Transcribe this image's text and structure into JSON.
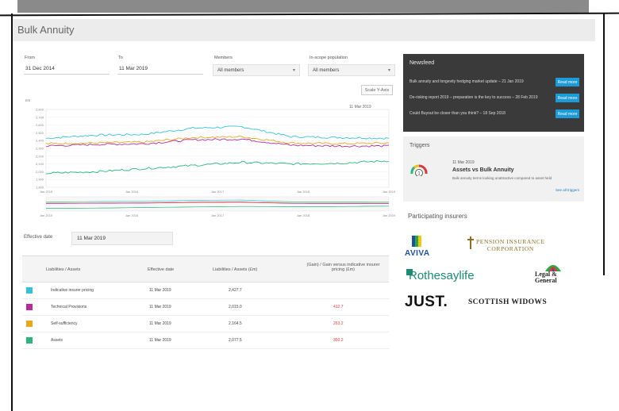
{
  "page": {
    "title": "Bulk Annuity"
  },
  "filters": {
    "from_label": "From",
    "from_value": "31 Dec 2014",
    "to_label": "To",
    "to_value": "11 Mar 2019",
    "members_label": "Members",
    "members_value": "All members",
    "in_scope_label": "In-scope population",
    "in_scope_value": "All members"
  },
  "scale_button": "Scale Y-Axis",
  "chart_data": {
    "type": "line",
    "date_label": "11 Mar 2019",
    "ylabel": "£m",
    "x": [
      "Jan 2015",
      "Jan 2016",
      "Jan 2017",
      "Jan 2018",
      "Jan 2019"
    ],
    "y_ticks": [
      "2,800",
      "2,700",
      "2,600",
      "2,500",
      "2,400",
      "2,300",
      "2,200",
      "2,100",
      "2,000",
      "1,900",
      "1,800"
    ],
    "ylim": [
      1800,
      2800
    ],
    "series": [
      {
        "color": "#35c2d9",
        "values": [
          2430,
          2470,
          2480,
          2560,
          2580,
          2450,
          2440,
          2430
        ]
      },
      {
        "color": "#e8a820",
        "values": [
          2360,
          2370,
          2380,
          2440,
          2450,
          2370,
          2360,
          2370
        ]
      },
      {
        "color": "#b8299a",
        "values": [
          2330,
          2350,
          2360,
          2410,
          2420,
          2340,
          2330,
          2330
        ]
      },
      {
        "color": "#2ab67c",
        "values": [
          1980,
          2000,
          2040,
          2080,
          2120,
          2100,
          2110,
          2140
        ]
      }
    ],
    "navigator_x": [
      "Jan 2015",
      "Jan 2016",
      "Jan 2017",
      "Jan 2018",
      "Jan 2019"
    ],
    "grid": true
  },
  "effective": {
    "label": "Effective date",
    "value": "11 Mar 2019"
  },
  "table": {
    "headers": [
      "Liabilities / Assets",
      "Effective date",
      "Liabilities / Assets (£m)",
      "(Gain) / Gain versus indicative insurer pricing (£m)"
    ],
    "rows": [
      {
        "color": "#35c2d9",
        "name": "Indicative insurer pricing",
        "date": "11 Mar 2019",
        "value": "2,427.7",
        "gain": ""
      },
      {
        "color": "#b8299a",
        "name": "Technical Provisions",
        "date": "11 Mar 2019",
        "value": "2,015.0",
        "gain": "412.7"
      },
      {
        "color": "#e8a820",
        "name": "Self-sufficiency",
        "date": "11 Mar 2019",
        "value": "2,164.5",
        "gain": "263.2"
      },
      {
        "color": "#2ab67c",
        "name": "Assets",
        "date": "11 Mar 2019",
        "value": "2,077.5",
        "gain": "350.2"
      }
    ]
  },
  "newsfeed": {
    "title": "Newsfeed",
    "items": [
      {
        "text": "Bulk annuity and longevity hedging market update – 21 Jan 2019",
        "button": "Read more"
      },
      {
        "text": "De-risking report 2019 – preparation is the key to success – 28 Feb 2019",
        "button": "Read more"
      },
      {
        "text": "Could Buyout be closer than you think? – 18 Sep 2018",
        "button": "Read more"
      }
    ]
  },
  "triggers": {
    "title": "Triggers",
    "date": "11 Mar 2019",
    "name": "Assets vs Bulk Annuity",
    "description": "Bulk annuity terms looking unattractive compared to asset held",
    "gauge_value": "1",
    "link": "See all triggers"
  },
  "insurers": {
    "title": "Participating insurers",
    "aviva": "AVIVA",
    "pic": "PENSION INSURANCE\nCORPORATION",
    "rothesay": "Rothesaylife",
    "legal": "Legal &\nGeneral",
    "just": "JUST.",
    "scottish": "SCOTTISH WIDOWS"
  }
}
